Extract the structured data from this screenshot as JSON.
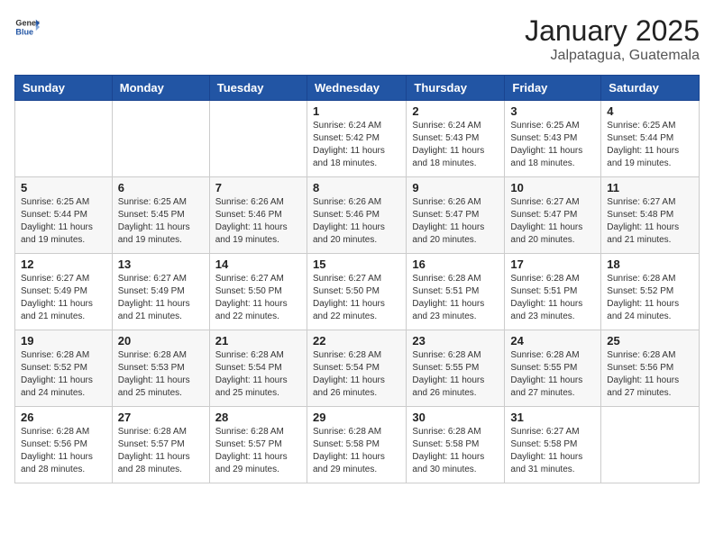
{
  "header": {
    "logo_general": "General",
    "logo_blue": "Blue",
    "title": "January 2025",
    "location": "Jalpatagua, Guatemala"
  },
  "calendar": {
    "days_of_week": [
      "Sunday",
      "Monday",
      "Tuesday",
      "Wednesday",
      "Thursday",
      "Friday",
      "Saturday"
    ],
    "weeks": [
      [
        {
          "day": "",
          "info": ""
        },
        {
          "day": "",
          "info": ""
        },
        {
          "day": "",
          "info": ""
        },
        {
          "day": "1",
          "info": "Sunrise: 6:24 AM\nSunset: 5:42 PM\nDaylight: 11 hours and 18 minutes."
        },
        {
          "day": "2",
          "info": "Sunrise: 6:24 AM\nSunset: 5:43 PM\nDaylight: 11 hours and 18 minutes."
        },
        {
          "day": "3",
          "info": "Sunrise: 6:25 AM\nSunset: 5:43 PM\nDaylight: 11 hours and 18 minutes."
        },
        {
          "day": "4",
          "info": "Sunrise: 6:25 AM\nSunset: 5:44 PM\nDaylight: 11 hours and 19 minutes."
        }
      ],
      [
        {
          "day": "5",
          "info": "Sunrise: 6:25 AM\nSunset: 5:44 PM\nDaylight: 11 hours and 19 minutes."
        },
        {
          "day": "6",
          "info": "Sunrise: 6:25 AM\nSunset: 5:45 PM\nDaylight: 11 hours and 19 minutes."
        },
        {
          "day": "7",
          "info": "Sunrise: 6:26 AM\nSunset: 5:46 PM\nDaylight: 11 hours and 19 minutes."
        },
        {
          "day": "8",
          "info": "Sunrise: 6:26 AM\nSunset: 5:46 PM\nDaylight: 11 hours and 20 minutes."
        },
        {
          "day": "9",
          "info": "Sunrise: 6:26 AM\nSunset: 5:47 PM\nDaylight: 11 hours and 20 minutes."
        },
        {
          "day": "10",
          "info": "Sunrise: 6:27 AM\nSunset: 5:47 PM\nDaylight: 11 hours and 20 minutes."
        },
        {
          "day": "11",
          "info": "Sunrise: 6:27 AM\nSunset: 5:48 PM\nDaylight: 11 hours and 21 minutes."
        }
      ],
      [
        {
          "day": "12",
          "info": "Sunrise: 6:27 AM\nSunset: 5:49 PM\nDaylight: 11 hours and 21 minutes."
        },
        {
          "day": "13",
          "info": "Sunrise: 6:27 AM\nSunset: 5:49 PM\nDaylight: 11 hours and 21 minutes."
        },
        {
          "day": "14",
          "info": "Sunrise: 6:27 AM\nSunset: 5:50 PM\nDaylight: 11 hours and 22 minutes."
        },
        {
          "day": "15",
          "info": "Sunrise: 6:27 AM\nSunset: 5:50 PM\nDaylight: 11 hours and 22 minutes."
        },
        {
          "day": "16",
          "info": "Sunrise: 6:28 AM\nSunset: 5:51 PM\nDaylight: 11 hours and 23 minutes."
        },
        {
          "day": "17",
          "info": "Sunrise: 6:28 AM\nSunset: 5:51 PM\nDaylight: 11 hours and 23 minutes."
        },
        {
          "day": "18",
          "info": "Sunrise: 6:28 AM\nSunset: 5:52 PM\nDaylight: 11 hours and 24 minutes."
        }
      ],
      [
        {
          "day": "19",
          "info": "Sunrise: 6:28 AM\nSunset: 5:52 PM\nDaylight: 11 hours and 24 minutes."
        },
        {
          "day": "20",
          "info": "Sunrise: 6:28 AM\nSunset: 5:53 PM\nDaylight: 11 hours and 25 minutes."
        },
        {
          "day": "21",
          "info": "Sunrise: 6:28 AM\nSunset: 5:54 PM\nDaylight: 11 hours and 25 minutes."
        },
        {
          "day": "22",
          "info": "Sunrise: 6:28 AM\nSunset: 5:54 PM\nDaylight: 11 hours and 26 minutes."
        },
        {
          "day": "23",
          "info": "Sunrise: 6:28 AM\nSunset: 5:55 PM\nDaylight: 11 hours and 26 minutes."
        },
        {
          "day": "24",
          "info": "Sunrise: 6:28 AM\nSunset: 5:55 PM\nDaylight: 11 hours and 27 minutes."
        },
        {
          "day": "25",
          "info": "Sunrise: 6:28 AM\nSunset: 5:56 PM\nDaylight: 11 hours and 27 minutes."
        }
      ],
      [
        {
          "day": "26",
          "info": "Sunrise: 6:28 AM\nSunset: 5:56 PM\nDaylight: 11 hours and 28 minutes."
        },
        {
          "day": "27",
          "info": "Sunrise: 6:28 AM\nSunset: 5:57 PM\nDaylight: 11 hours and 28 minutes."
        },
        {
          "day": "28",
          "info": "Sunrise: 6:28 AM\nSunset: 5:57 PM\nDaylight: 11 hours and 29 minutes."
        },
        {
          "day": "29",
          "info": "Sunrise: 6:28 AM\nSunset: 5:58 PM\nDaylight: 11 hours and 29 minutes."
        },
        {
          "day": "30",
          "info": "Sunrise: 6:28 AM\nSunset: 5:58 PM\nDaylight: 11 hours and 30 minutes."
        },
        {
          "day": "31",
          "info": "Sunrise: 6:27 AM\nSunset: 5:58 PM\nDaylight: 11 hours and 31 minutes."
        },
        {
          "day": "",
          "info": ""
        }
      ]
    ]
  }
}
